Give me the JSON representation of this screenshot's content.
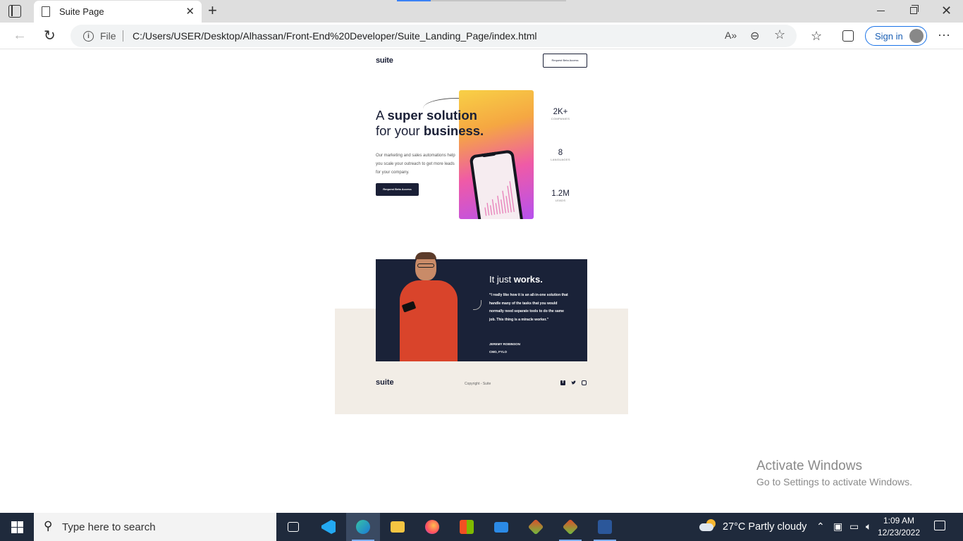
{
  "browser": {
    "tab_title": "Suite Page",
    "file_label": "File",
    "url": "C:/Users/USER/Desktop/Alhassan/Front-End%20Developer/Suite_Landing_Page/index.html",
    "signin_label": "Sign in"
  },
  "page": {
    "logo": "suite",
    "header_button": "Request Beta Access",
    "hero": {
      "title_plain_1": "A ",
      "title_bold_1": "super solution",
      "title_plain_2": "for your ",
      "title_bold_2": "business.",
      "description": "Our marketing and sales automations help you scale your outreach to get more leads for your company.",
      "cta": "Request Beta Access"
    },
    "stats": [
      {
        "value": "2K+",
        "label": "COMPANIES"
      },
      {
        "value": "8",
        "label": "LANGUAGES"
      },
      {
        "value": "1.2M",
        "label": "LEADS"
      }
    ],
    "testimonial": {
      "title_plain": "It just ",
      "title_bold": "works.",
      "quote": "“I really like how it is an all-in-one solution that handle many of the tasks that you would normally need separate tools to do the same job. This thing is a miracle worker.”",
      "name": "JEREMY ROBINSON",
      "role": "CMO, FYLO"
    },
    "footer": {
      "logo": "suite",
      "copyright": "Copyright - Suite",
      "social_icons": [
        "facebook-icon",
        "twitter-icon",
        "instagram-icon"
      ]
    }
  },
  "watermark": {
    "title": "Activate Windows",
    "subtitle": "Go to Settings to activate Windows."
  },
  "taskbar": {
    "search_placeholder": "Type here to search",
    "apps": [
      "task-view",
      "vscode",
      "edge",
      "file-explorer",
      "firefox",
      "microsoft-store",
      "mail",
      "git-gui",
      "git-gui-2",
      "word"
    ],
    "weather": "27°C  Partly cloudy",
    "time": "1:09 AM",
    "date": "12/23/2022"
  },
  "colors": {
    "navy": "#1a1f36",
    "testimonial_bg": "#1a2238",
    "footer_bg": "#f2ede6",
    "taskbar_bg": "#1f2a3c"
  }
}
